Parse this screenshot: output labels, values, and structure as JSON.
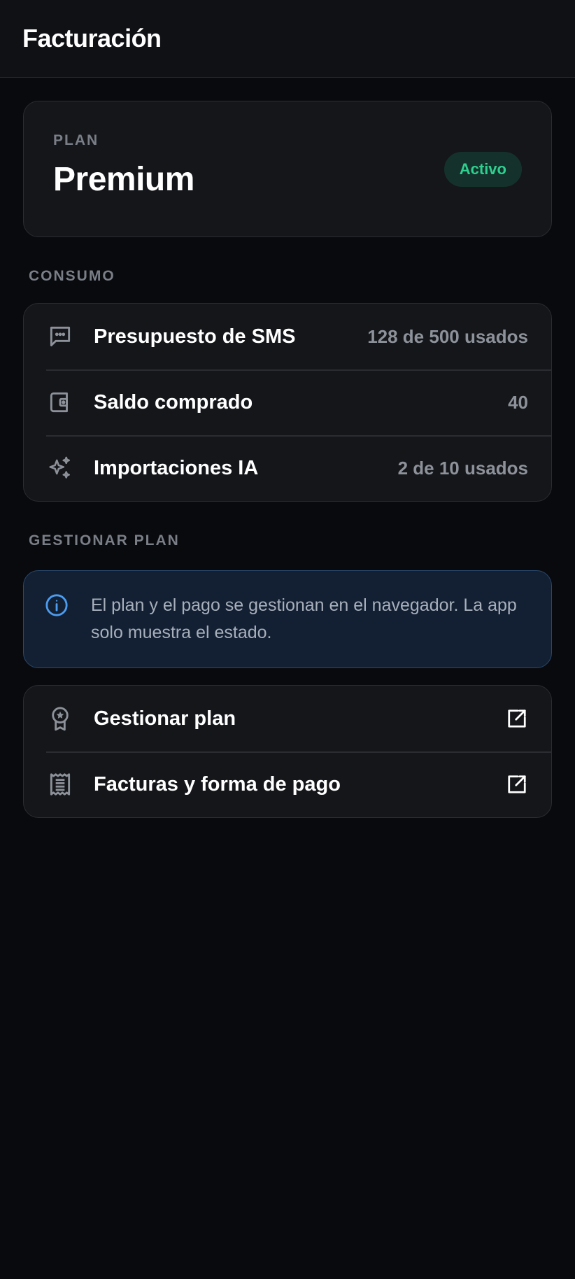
{
  "header": {
    "title": "Facturación"
  },
  "plan": {
    "label": "PLAN",
    "name": "Premium",
    "status": "Activo"
  },
  "consumo": {
    "section_label": "CONSUMO",
    "items": [
      {
        "icon": "message-dots-icon",
        "label": "Presupuesto de SMS",
        "value": "128 de 500 usados"
      },
      {
        "icon": "wallet-icon",
        "label": "Saldo comprado",
        "value": "40"
      },
      {
        "icon": "sparkles-icon",
        "label": "Importaciones IA",
        "value": "2 de 10 usados"
      }
    ]
  },
  "gestionar": {
    "section_label": "GESTIONAR PLAN",
    "info": "El plan y el pago se gestionan en el navegador. La app solo muestra el estado.",
    "items": [
      {
        "icon": "award-icon",
        "label": "Gestionar plan"
      },
      {
        "icon": "receipt-icon",
        "label": "Facturas y forma de pago"
      }
    ]
  },
  "colors": {
    "background": "#090a0e",
    "card": "#14161a",
    "accent_green": "#2fcf8f",
    "info_blue": "#4c9cf0"
  }
}
